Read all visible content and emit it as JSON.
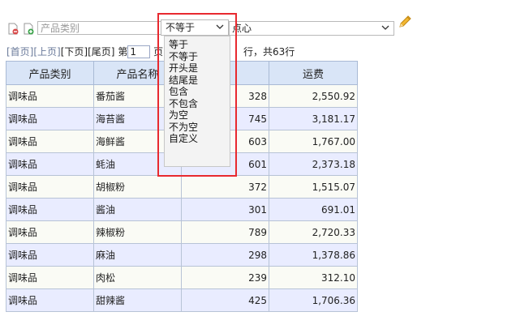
{
  "toolbar": {
    "remove_icon": "remove-filter-icon",
    "add_icon": "add-filter-icon",
    "edit_icon": "pencil-icon",
    "field_placeholder": "产品类别",
    "operator_value": "不等于",
    "value_text": "点心"
  },
  "operator_options": [
    "等于",
    "不等于",
    "开头是",
    "结尾是",
    "包含",
    "不包含",
    "为空",
    "不为空",
    "自定义"
  ],
  "pager": {
    "first": "[首页]",
    "prev": "[上页]",
    "next": "[下页]",
    "last": "[尾页]",
    "page_prefix": "第",
    "page_value": "1",
    "page_suffix": "页",
    "total_text": "行，共63行"
  },
  "table": {
    "columns": [
      "产品类别",
      "产品名称",
      "",
      "运费"
    ],
    "rows": [
      [
        "调味品",
        "番茄酱",
        "328",
        "2,550.92"
      ],
      [
        "调味品",
        "海苔酱",
        "745",
        "3,181.17"
      ],
      [
        "调味品",
        "海鲜酱",
        "603",
        "1,767.00"
      ],
      [
        "调味品",
        "蚝油",
        "601",
        "2,373.18"
      ],
      [
        "调味品",
        "胡椒粉",
        "372",
        "1,515.07"
      ],
      [
        "调味品",
        "酱油",
        "301",
        "691.01"
      ],
      [
        "调味品",
        "辣椒粉",
        "789",
        "2,720.33"
      ],
      [
        "调味品",
        "麻油",
        "298",
        "1,378.86"
      ],
      [
        "调味品",
        "肉松",
        "239",
        "312.10"
      ],
      [
        "调味品",
        "甜辣酱",
        "425",
        "1,706.36"
      ]
    ]
  },
  "colors": {
    "header_bg": "#d9e5f7",
    "row_even_bg": "#e9ecff",
    "row_odd_bg": "#fafbf5",
    "highlight_border": "#e8292f",
    "link_color": "#6a7a9a"
  }
}
